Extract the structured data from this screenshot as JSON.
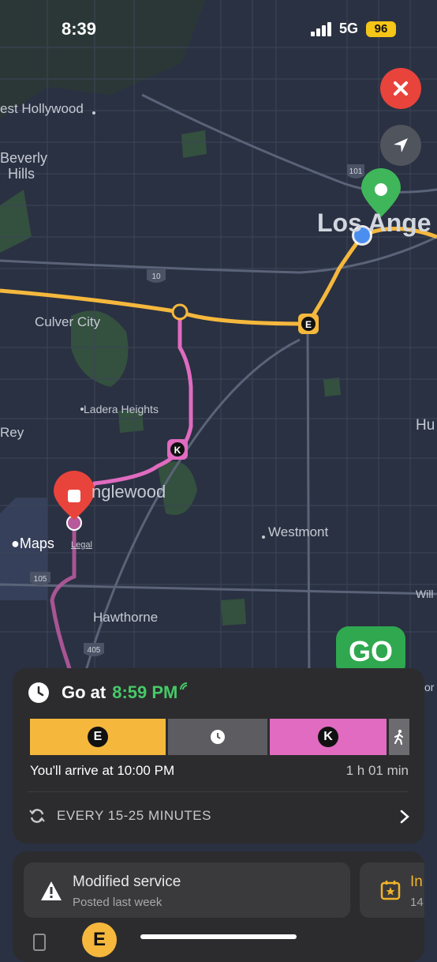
{
  "status": {
    "time": "8:39",
    "network": "5G",
    "battery": "96"
  },
  "map": {
    "labels": {
      "west_hollywood": "est Hollywood",
      "beverly": "Beverly",
      "hills": "Hills",
      "los_angeles": "Los Ange",
      "culver_city": "Culver City",
      "ladera": "Ladera Heights",
      "rey": "Rey",
      "inglewood": "nglewood",
      "westmont": "Westmont",
      "hu": "Hu",
      "hawthorne": "Hawthorne",
      "will": "Will",
      "or": "or"
    },
    "shields": {
      "i101": "101",
      "i10": "10",
      "i105": "105",
      "i405": "405"
    },
    "line_badges": {
      "e": "E",
      "k": "K"
    },
    "attribution": {
      "logo": "Maps",
      "legal": "Legal"
    },
    "colors": {
      "e_line": "#f5b83d",
      "k_line": "#e06bc0",
      "walk": "#b65a9c",
      "origin_pin": "#3fb65a",
      "dest_pin": "#e8443c",
      "current_location": "#4a8ff0"
    }
  },
  "controls": {
    "close_icon": "close-icon",
    "location_icon": "location-arrow-icon",
    "go_label": "GO"
  },
  "trip": {
    "go_at_label": "Go at",
    "go_time": "8:59 PM",
    "segments": [
      {
        "type": "E line",
        "badge": "E"
      },
      {
        "type": "wait",
        "icon": "clock-icon"
      },
      {
        "type": "K line",
        "badge": "K"
      },
      {
        "type": "walk",
        "icon": "walk-icon"
      }
    ],
    "arrive": "You'll arrive at 10:00 PM",
    "duration": "1 h 01 min",
    "frequency": "EVERY 15-25 MINUTES"
  },
  "alerts": {
    "modified": {
      "title": "Modified service",
      "subtitle": "Posted last week"
    },
    "second": {
      "title": "In",
      "subtitle": "14"
    }
  },
  "bottom_badge": "E"
}
